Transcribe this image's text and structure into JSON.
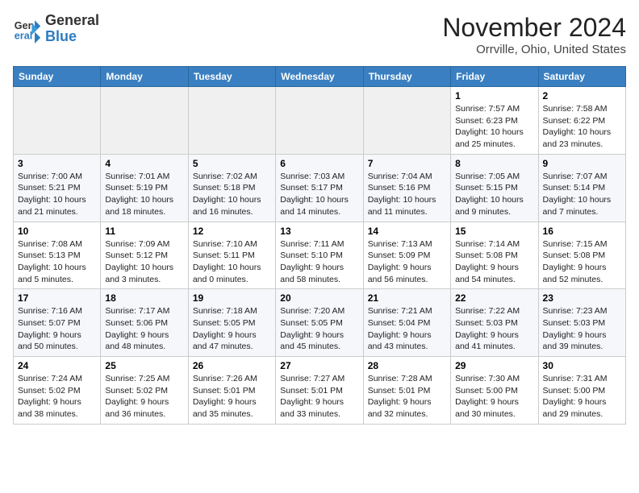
{
  "header": {
    "logo_general": "General",
    "logo_blue": "Blue",
    "month_year": "November 2024",
    "location": "Orrville, Ohio, United States"
  },
  "days_of_week": [
    "Sunday",
    "Monday",
    "Tuesday",
    "Wednesday",
    "Thursday",
    "Friday",
    "Saturday"
  ],
  "weeks": [
    [
      {
        "num": "",
        "info": "",
        "empty": true
      },
      {
        "num": "",
        "info": "",
        "empty": true
      },
      {
        "num": "",
        "info": "",
        "empty": true
      },
      {
        "num": "",
        "info": "",
        "empty": true
      },
      {
        "num": "",
        "info": "",
        "empty": true
      },
      {
        "num": "1",
        "info": "Sunrise: 7:57 AM\nSunset: 6:23 PM\nDaylight: 10 hours\nand 25 minutes."
      },
      {
        "num": "2",
        "info": "Sunrise: 7:58 AM\nSunset: 6:22 PM\nDaylight: 10 hours\nand 23 minutes."
      }
    ],
    [
      {
        "num": "3",
        "info": "Sunrise: 7:00 AM\nSunset: 5:21 PM\nDaylight: 10 hours\nand 21 minutes."
      },
      {
        "num": "4",
        "info": "Sunrise: 7:01 AM\nSunset: 5:19 PM\nDaylight: 10 hours\nand 18 minutes."
      },
      {
        "num": "5",
        "info": "Sunrise: 7:02 AM\nSunset: 5:18 PM\nDaylight: 10 hours\nand 16 minutes."
      },
      {
        "num": "6",
        "info": "Sunrise: 7:03 AM\nSunset: 5:17 PM\nDaylight: 10 hours\nand 14 minutes."
      },
      {
        "num": "7",
        "info": "Sunrise: 7:04 AM\nSunset: 5:16 PM\nDaylight: 10 hours\nand 11 minutes."
      },
      {
        "num": "8",
        "info": "Sunrise: 7:05 AM\nSunset: 5:15 PM\nDaylight: 10 hours\nand 9 minutes."
      },
      {
        "num": "9",
        "info": "Sunrise: 7:07 AM\nSunset: 5:14 PM\nDaylight: 10 hours\nand 7 minutes."
      }
    ],
    [
      {
        "num": "10",
        "info": "Sunrise: 7:08 AM\nSunset: 5:13 PM\nDaylight: 10 hours\nand 5 minutes."
      },
      {
        "num": "11",
        "info": "Sunrise: 7:09 AM\nSunset: 5:12 PM\nDaylight: 10 hours\nand 3 minutes."
      },
      {
        "num": "12",
        "info": "Sunrise: 7:10 AM\nSunset: 5:11 PM\nDaylight: 10 hours\nand 0 minutes."
      },
      {
        "num": "13",
        "info": "Sunrise: 7:11 AM\nSunset: 5:10 PM\nDaylight: 9 hours\nand 58 minutes."
      },
      {
        "num": "14",
        "info": "Sunrise: 7:13 AM\nSunset: 5:09 PM\nDaylight: 9 hours\nand 56 minutes."
      },
      {
        "num": "15",
        "info": "Sunrise: 7:14 AM\nSunset: 5:08 PM\nDaylight: 9 hours\nand 54 minutes."
      },
      {
        "num": "16",
        "info": "Sunrise: 7:15 AM\nSunset: 5:08 PM\nDaylight: 9 hours\nand 52 minutes."
      }
    ],
    [
      {
        "num": "17",
        "info": "Sunrise: 7:16 AM\nSunset: 5:07 PM\nDaylight: 9 hours\nand 50 minutes."
      },
      {
        "num": "18",
        "info": "Sunrise: 7:17 AM\nSunset: 5:06 PM\nDaylight: 9 hours\nand 48 minutes."
      },
      {
        "num": "19",
        "info": "Sunrise: 7:18 AM\nSunset: 5:05 PM\nDaylight: 9 hours\nand 47 minutes."
      },
      {
        "num": "20",
        "info": "Sunrise: 7:20 AM\nSunset: 5:05 PM\nDaylight: 9 hours\nand 45 minutes."
      },
      {
        "num": "21",
        "info": "Sunrise: 7:21 AM\nSunset: 5:04 PM\nDaylight: 9 hours\nand 43 minutes."
      },
      {
        "num": "22",
        "info": "Sunrise: 7:22 AM\nSunset: 5:03 PM\nDaylight: 9 hours\nand 41 minutes."
      },
      {
        "num": "23",
        "info": "Sunrise: 7:23 AM\nSunset: 5:03 PM\nDaylight: 9 hours\nand 39 minutes."
      }
    ],
    [
      {
        "num": "24",
        "info": "Sunrise: 7:24 AM\nSunset: 5:02 PM\nDaylight: 9 hours\nand 38 minutes."
      },
      {
        "num": "25",
        "info": "Sunrise: 7:25 AM\nSunset: 5:02 PM\nDaylight: 9 hours\nand 36 minutes."
      },
      {
        "num": "26",
        "info": "Sunrise: 7:26 AM\nSunset: 5:01 PM\nDaylight: 9 hours\nand 35 minutes."
      },
      {
        "num": "27",
        "info": "Sunrise: 7:27 AM\nSunset: 5:01 PM\nDaylight: 9 hours\nand 33 minutes."
      },
      {
        "num": "28",
        "info": "Sunrise: 7:28 AM\nSunset: 5:01 PM\nDaylight: 9 hours\nand 32 minutes."
      },
      {
        "num": "29",
        "info": "Sunrise: 7:30 AM\nSunset: 5:00 PM\nDaylight: 9 hours\nand 30 minutes."
      },
      {
        "num": "30",
        "info": "Sunrise: 7:31 AM\nSunset: 5:00 PM\nDaylight: 9 hours\nand 29 minutes."
      }
    ]
  ]
}
